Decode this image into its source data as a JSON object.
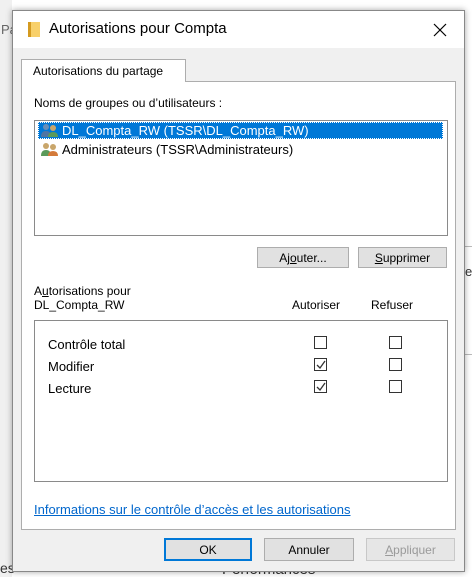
{
  "background": {
    "left_fragment": "Pa",
    "right_fragment": "e",
    "bottom_left_fragment": "es",
    "bottom_mid_fragment": "Performances"
  },
  "dialog": {
    "title": "Autorisations pour Compta",
    "title_icon": "folder-icon",
    "close_icon": "close-icon"
  },
  "tab": {
    "label": "Autorisations du partage"
  },
  "groups": {
    "label_pre": "Noms de ",
    "label_accel": "g",
    "label_post": "roupes ou d’utilisateurs :",
    "items": [
      {
        "name": "DL_Compta_RW (TSSR\\DL_Compta_RW)",
        "selected": true,
        "icon": "user-group-icon"
      },
      {
        "name": "Administrateurs (TSSR\\Administrateurs)",
        "selected": false,
        "icon": "user-group-icon"
      }
    ]
  },
  "buttons": {
    "add_pre": "Aj",
    "add_accel": "o",
    "add_post": "uter...",
    "remove_pre": "",
    "remove_accel": "S",
    "remove_post": "upprimer",
    "ok": "OK",
    "cancel": "Annuler",
    "apply_pre": "",
    "apply_accel": "A",
    "apply_post": "ppliquer"
  },
  "permissions": {
    "header_line1_pre": "A",
    "header_line1_accel": "u",
    "header_line1_post": "torisations pour",
    "header_line2": "DL_Compta_RW",
    "allow_header": "Autoriser",
    "deny_header": "Refuser",
    "rows": [
      {
        "label": "Contrôle total",
        "allow": false,
        "deny": false
      },
      {
        "label": "Modifier",
        "allow": true,
        "deny": false
      },
      {
        "label": "Lecture",
        "allow": true,
        "deny": false
      }
    ]
  },
  "link": {
    "text": "Informations sur le contrôle d’accès et les autorisations"
  },
  "colors": {
    "selection": "#0078d7",
    "link": "#0066cc",
    "dialog_bg": "#f0f0f0"
  }
}
